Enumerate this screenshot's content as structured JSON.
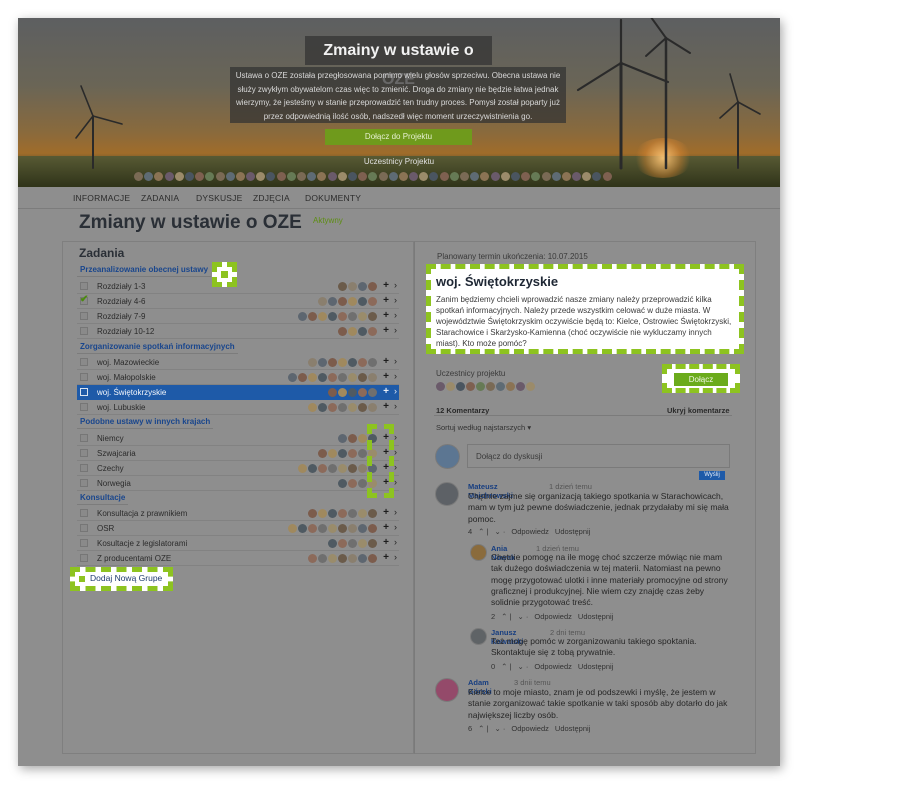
{
  "hero": {
    "title": "Zmainy w ustawie o OZE",
    "description": "Ustawa o OZE została przegłosowana pomimo wielu głosów sprzeciwu. Obecna ustawa nie służy zwykłym obywatelom czas więc to zmienić. Droga do zmiany nie będzie łatwa jednak wierzymy, że jesteśmy w stanie przeprowadzić ten trudny proces. Pomysł został poparty już przez odpowiednią ilość osób, nadszedł więc moment urzeczywistnienia go.",
    "join_label": "Dołącz do Projektu",
    "participants_label": "Uczestnicy Projektu"
  },
  "nav": {
    "items": [
      "INFORMACJE",
      "ZADANIA",
      "DYSKUSJE",
      "ZDJĘCIA",
      "DOKUMENTY"
    ]
  },
  "page": {
    "title": "Zmiany w ustawie o OZE",
    "status": "Aktywny"
  },
  "tasks": {
    "title": "Zadania",
    "add_group_label": "Dodaj Nową Grupe",
    "groups": [
      {
        "name": "Przeanalizowanie obecnej ustawy",
        "rows": [
          {
            "name": "Rozdziały 1-3",
            "done": false
          },
          {
            "name": "Rozdziały 4-6",
            "done": true
          },
          {
            "name": "Rozdziały 7-9",
            "done": false
          },
          {
            "name": "Rozdziały 10-12",
            "done": false
          }
        ]
      },
      {
        "name": "Zorganizowanie spotkań informacyjnych",
        "rows": [
          {
            "name": "woj. Mazowieckie",
            "done": false
          },
          {
            "name": "woj. Małopolskie",
            "done": false
          },
          {
            "name": "woj. Świętokrzyskie",
            "done": false,
            "selected": true
          },
          {
            "name": "woj. Lubuskie",
            "done": false
          }
        ]
      },
      {
        "name": "Podobne ustawy w innych krajach",
        "rows": [
          {
            "name": "Niemcy",
            "done": false
          },
          {
            "name": "Szwajcaria",
            "done": false
          },
          {
            "name": "Czechy",
            "done": false
          },
          {
            "name": "Norwegia",
            "done": false
          }
        ]
      },
      {
        "name": "Konsultacje",
        "rows": [
          {
            "name": "Konsultacja z prawnikiem",
            "done": false
          },
          {
            "name": "OSR",
            "done": false
          },
          {
            "name": "Kosultacje z legislatorami",
            "done": false
          },
          {
            "name": "Z producentami OZE",
            "done": false
          }
        ]
      }
    ]
  },
  "detail": {
    "planned_date": "Planowany termin ukończenia: 10.07.2015",
    "title": "woj. Świętokrzyskie",
    "text": "Zanim będziemy chcieli wprowadzić nasze zmiany należy przeprowadzić kilka spotkań informacyjnych. Należy przede wszystkim celować w duże miasta. W województwie Świętokrzyskim oczywiście będą to: Kielce, Ostrowiec Świętokrzyski, Starachowice i Skarżysko-Kamienna (choć oczywiście nie wykluczamy innych miast). Kto może pomóc?",
    "participants_label": "Uczestnicy projektu",
    "join_label": "Dołącz",
    "comments_count": "12 Komentarzy",
    "hide_comments": "Ukryj komentarze",
    "sort_label": "Sortuj według najstarszych",
    "input_placeholder": "Dołącz do dyskusji",
    "send_label": "Wyślij",
    "reply_label": "Odpowiedz",
    "share_label": "Udostępnij"
  },
  "comments": [
    {
      "author": "Mateusz Majchrowski",
      "time": "1 dzień temu",
      "body": "Chętnie zajme się organizacją takiego spotkania w Starachowicach, mam w tym już pewne doświadczenie, jednak przydałaby mi się mała pomoc.",
      "votes": "4"
    },
    {
      "author": "Ania Nowak",
      "time": "1 dzień temu",
      "body": "Chętnie pomogę na ile mogę choć szczerze mówiąc nie mam tak dużego doświadczenia w tej materii. Natomiast na pewno mogę przygotować ulotki i inne materiały promocyjne od strony graficznej i produkcyjnej. Nie wiem czy znajdę czas żeby solidnie przygotować treść.",
      "votes": "2"
    },
    {
      "author": "Janusz Kowalski",
      "time": "2 dni temu",
      "body": "Też mogę pomóc w zorganizowaniu takiego spoktania. Skontaktuje się z tobą prywatnie.",
      "votes": "0"
    },
    {
      "author": "Adam Górski",
      "time": "3 dnii temu",
      "body": "Kielce to moje miasto, znam je od podszewki i myślę, że jestem w stanie zorganizować takie spotkanie w taki sposób aby dotarło do jak największej liczby osób.",
      "votes": "6"
    }
  ],
  "colors": {
    "accent_green": "#8dc320",
    "selected_blue": "#1e5aa8",
    "group_blue": "#19468d",
    "overlay_gray": "#8e8e8e"
  }
}
